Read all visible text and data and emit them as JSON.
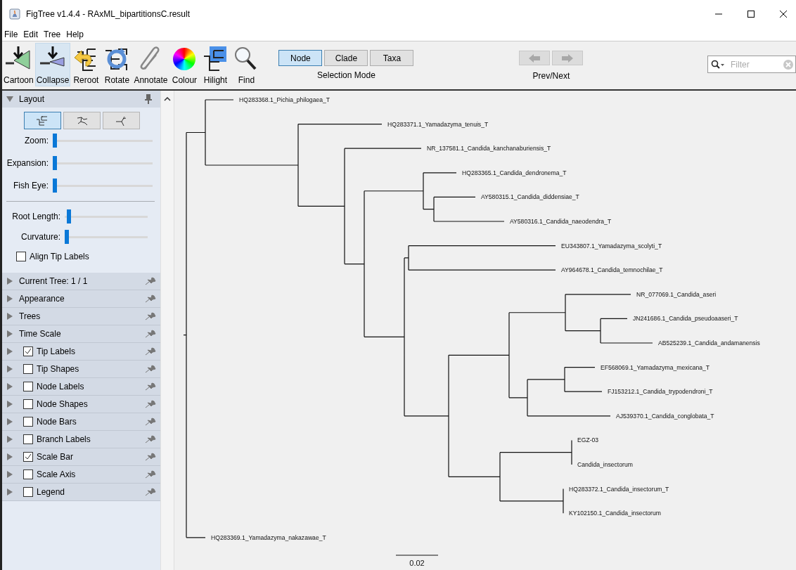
{
  "window": {
    "title": "FigTree v1.4.4 - RAxML_bipartitionsC.result"
  },
  "menu": [
    "File",
    "Edit",
    "Tree",
    "Help"
  ],
  "toolbar": {
    "tools": [
      {
        "kind": "cartoon",
        "label": "Cartoon",
        "selected": false
      },
      {
        "kind": "collapse",
        "label": "Collapse",
        "selected": true
      },
      {
        "kind": "reroot",
        "label": "Reroot",
        "selected": false
      },
      {
        "kind": "rotate",
        "label": "Rotate",
        "selected": false
      },
      {
        "kind": "annotate",
        "label": "Annotate",
        "selected": false
      },
      {
        "kind": "colour",
        "label": "Colour",
        "selected": false
      },
      {
        "kind": "hilight",
        "label": "Hilight",
        "selected": false
      },
      {
        "kind": "find",
        "label": "Find",
        "selected": false
      }
    ],
    "selection_mode": {
      "caption": "Selection Mode",
      "buttons": [
        {
          "label": "Node",
          "selected": true
        },
        {
          "label": "Clade",
          "selected": false
        },
        {
          "label": "Taxa",
          "selected": false
        }
      ]
    },
    "prev_next": {
      "caption": "Prev/Next",
      "buttons": [
        {
          "kind": "prev",
          "disabled": true
        },
        {
          "kind": "next",
          "disabled": true
        }
      ]
    },
    "filter": {
      "placeholder": "Filter"
    }
  },
  "sidebar": {
    "layout": {
      "title": "Layout",
      "expanded": true,
      "types": [
        {
          "kind": "rectangular",
          "selected": true
        },
        {
          "kind": "polar",
          "selected": false
        },
        {
          "kind": "radial",
          "selected": false
        }
      ],
      "sliders": [
        {
          "label": "Zoom:",
          "level": 0
        },
        {
          "label": "Expansion:",
          "level": 0
        },
        {
          "label": "Fish Eye:",
          "level": 0
        }
      ],
      "sliders_2": [
        {
          "label": "Root Length:",
          "level": 0.03
        },
        {
          "label": "Curvature:",
          "level": 0
        }
      ],
      "align_tip_labels": {
        "label": "Align Tip Labels",
        "checked": false
      }
    },
    "panels": [
      {
        "kind": "plain",
        "label": "Current Tree: 1 / 1"
      },
      {
        "kind": "plain",
        "label": "Appearance"
      },
      {
        "kind": "plain",
        "label": "Trees"
      },
      {
        "kind": "plain",
        "label": "Time Scale"
      },
      {
        "kind": "checkbox",
        "label": "Tip Labels",
        "checked": true
      },
      {
        "kind": "checkbox",
        "label": "Tip Shapes",
        "checked": false
      },
      {
        "kind": "checkbox",
        "label": "Node Labels",
        "checked": false
      },
      {
        "kind": "checkbox",
        "label": "Node Shapes",
        "checked": false
      },
      {
        "kind": "checkbox",
        "label": "Node Bars",
        "checked": false
      },
      {
        "kind": "checkbox",
        "label": "Branch Labels",
        "checked": false
      },
      {
        "kind": "checkbox",
        "label": "Scale Bar",
        "checked": true
      },
      {
        "kind": "checkbox",
        "label": "Scale Axis",
        "checked": false
      },
      {
        "kind": "checkbox",
        "label": "Legend",
        "checked": false
      }
    ]
  },
  "tree": {
    "children": [
      {
        "children": [
          {
            "label": "HQ283368.1_Pichia_philogaea_T"
          },
          {
            "children": [
              {
                "label": "HQ283371.1_Yamadazyma_tenuis_T"
              },
              {
                "children": [
                  {
                    "label": "NR_137581.1_Candida_kanchanaburiensis_T"
                  },
                  {
                    "children": [
                      {
                        "children": [
                          {
                            "label": "HQ283365.1_Candida_dendronema_T"
                          },
                          {
                            "children": [
                              {
                                "label": "AY580315.1_Candida_diddensiae_T"
                              },
                              {
                                "label": "AY580316.1_Candida_naeodendra_T"
                              }
                            ]
                          }
                        ]
                      },
                      {
                        "children": [
                          {
                            "children": [
                              {
                                "label": "EU343807.1_Yamadazyma_scolyti_T"
                              },
                              {
                                "label": "AY964678.1_Candida_temnochilae_T"
                              }
                            ]
                          },
                          {
                            "children": [
                              {
                                "children": [
                                  {
                                    "children": [
                                      {
                                        "label": "NR_077069.1_Candida_aseri"
                                      },
                                      {
                                        "children": [
                                          {
                                            "label": "JN241686.1_Candida_pseudoaaseri_T"
                                          },
                                          {
                                            "label": "AB525239.1_Candida_andamanensis"
                                          }
                                        ]
                                      }
                                    ]
                                  },
                                  {
                                    "children": [
                                      {
                                        "children": [
                                          {
                                            "label": "EF568069.1_Yamadazyma_mexicana_T"
                                          },
                                          {
                                            "label": "FJ153212.1_Candida_trypodendroni_T"
                                          }
                                        ]
                                      },
                                      {
                                        "label": "AJ539370.1_Candida_conglobata_T"
                                      }
                                    ]
                                  }
                                ]
                              },
                              {
                                "children": [
                                  {
                                    "children": [
                                      {
                                        "label": "EGZ-03"
                                      },
                                      {
                                        "label": "Candida_insectorum"
                                      }
                                    ]
                                  },
                                  {
                                    "children": [
                                      {
                                        "label": "HQ283372.1_Candida_insectorum_T"
                                      },
                                      {
                                        "label": "KY102150.1_Candida_insectorum"
                                      }
                                    ]
                                  }
                                ]
                              }
                            ]
                          }
                        ]
                      }
                    ]
                  }
                ]
              }
            ]
          }
        ]
      },
      {
        "label": "HQ283369.1_Yamadazyma_nakazawae_T"
      }
    ]
  },
  "scale_bar": {
    "label": "0.02"
  }
}
